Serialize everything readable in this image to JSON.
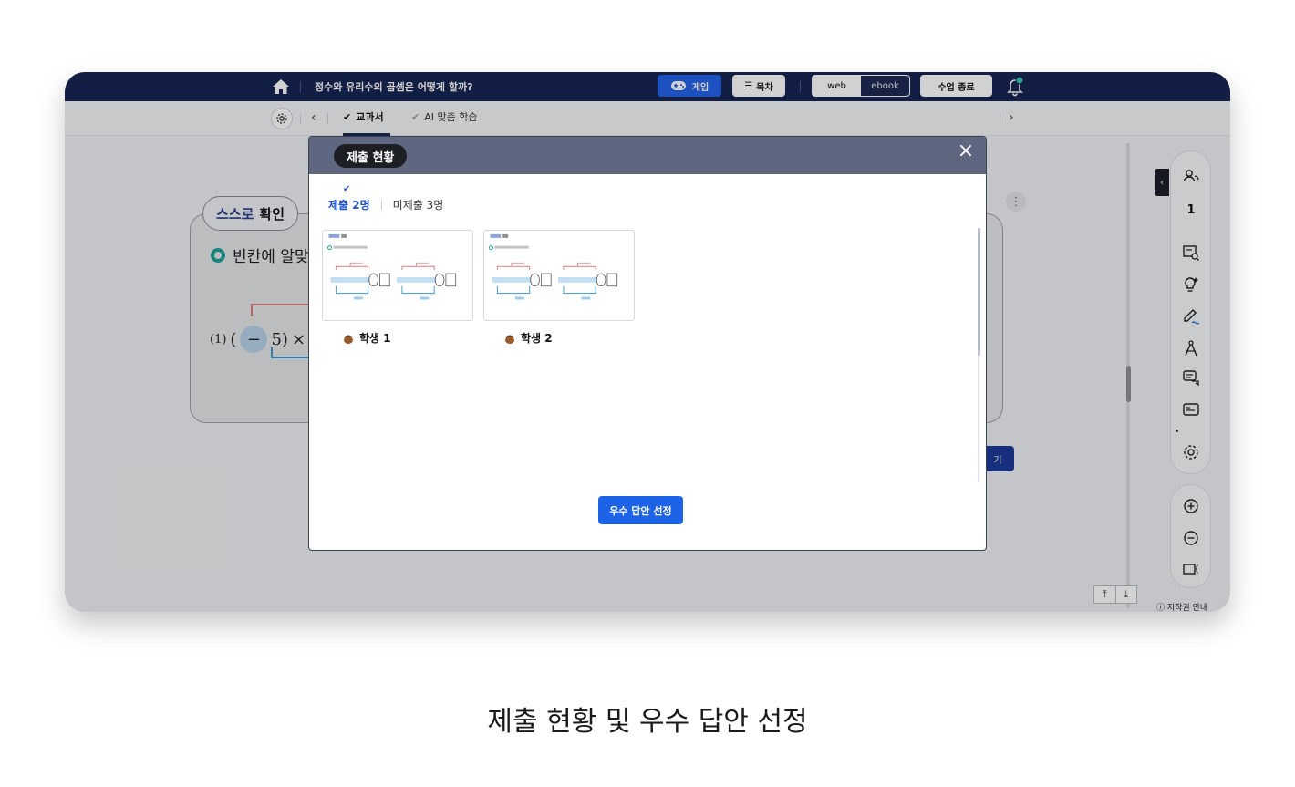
{
  "topbar": {
    "title": "정수와 유리수의 곱셈은 어떻게 할까?",
    "game_label": "게임",
    "toc_label": "목차",
    "mode_web": "web",
    "mode_ebook": "ebook",
    "end_class_label": "수업 종료"
  },
  "subnav": {
    "tab_textbook": "교과서",
    "tab_ai": "AI 맞춤 학습"
  },
  "background": {
    "self_check_a": "스스로",
    "self_check_b": "확인",
    "question": "빈칸에 알맞",
    "problem_number": "(1)",
    "paren_open": "(",
    "minus": "−",
    "five_close": "5)",
    "times": "×",
    "bg_button": "기",
    "kebab": "⋮"
  },
  "tools": {
    "count": "1",
    "copyright": "저작권 안내"
  },
  "modal": {
    "title": "제출 현황",
    "close": "×",
    "submitted": "제출 2명",
    "not_submitted": "미제출 3명",
    "students": [
      {
        "name": "학생 1"
      },
      {
        "name": "학생 2"
      }
    ],
    "best_answer_button": "우수 답안 선정"
  },
  "caption": "제출 현황 및 우수 답안 선정",
  "colors": {
    "navy": "#162552",
    "accent_blue": "#1d63e8",
    "modal_header": "#5e6680"
  }
}
